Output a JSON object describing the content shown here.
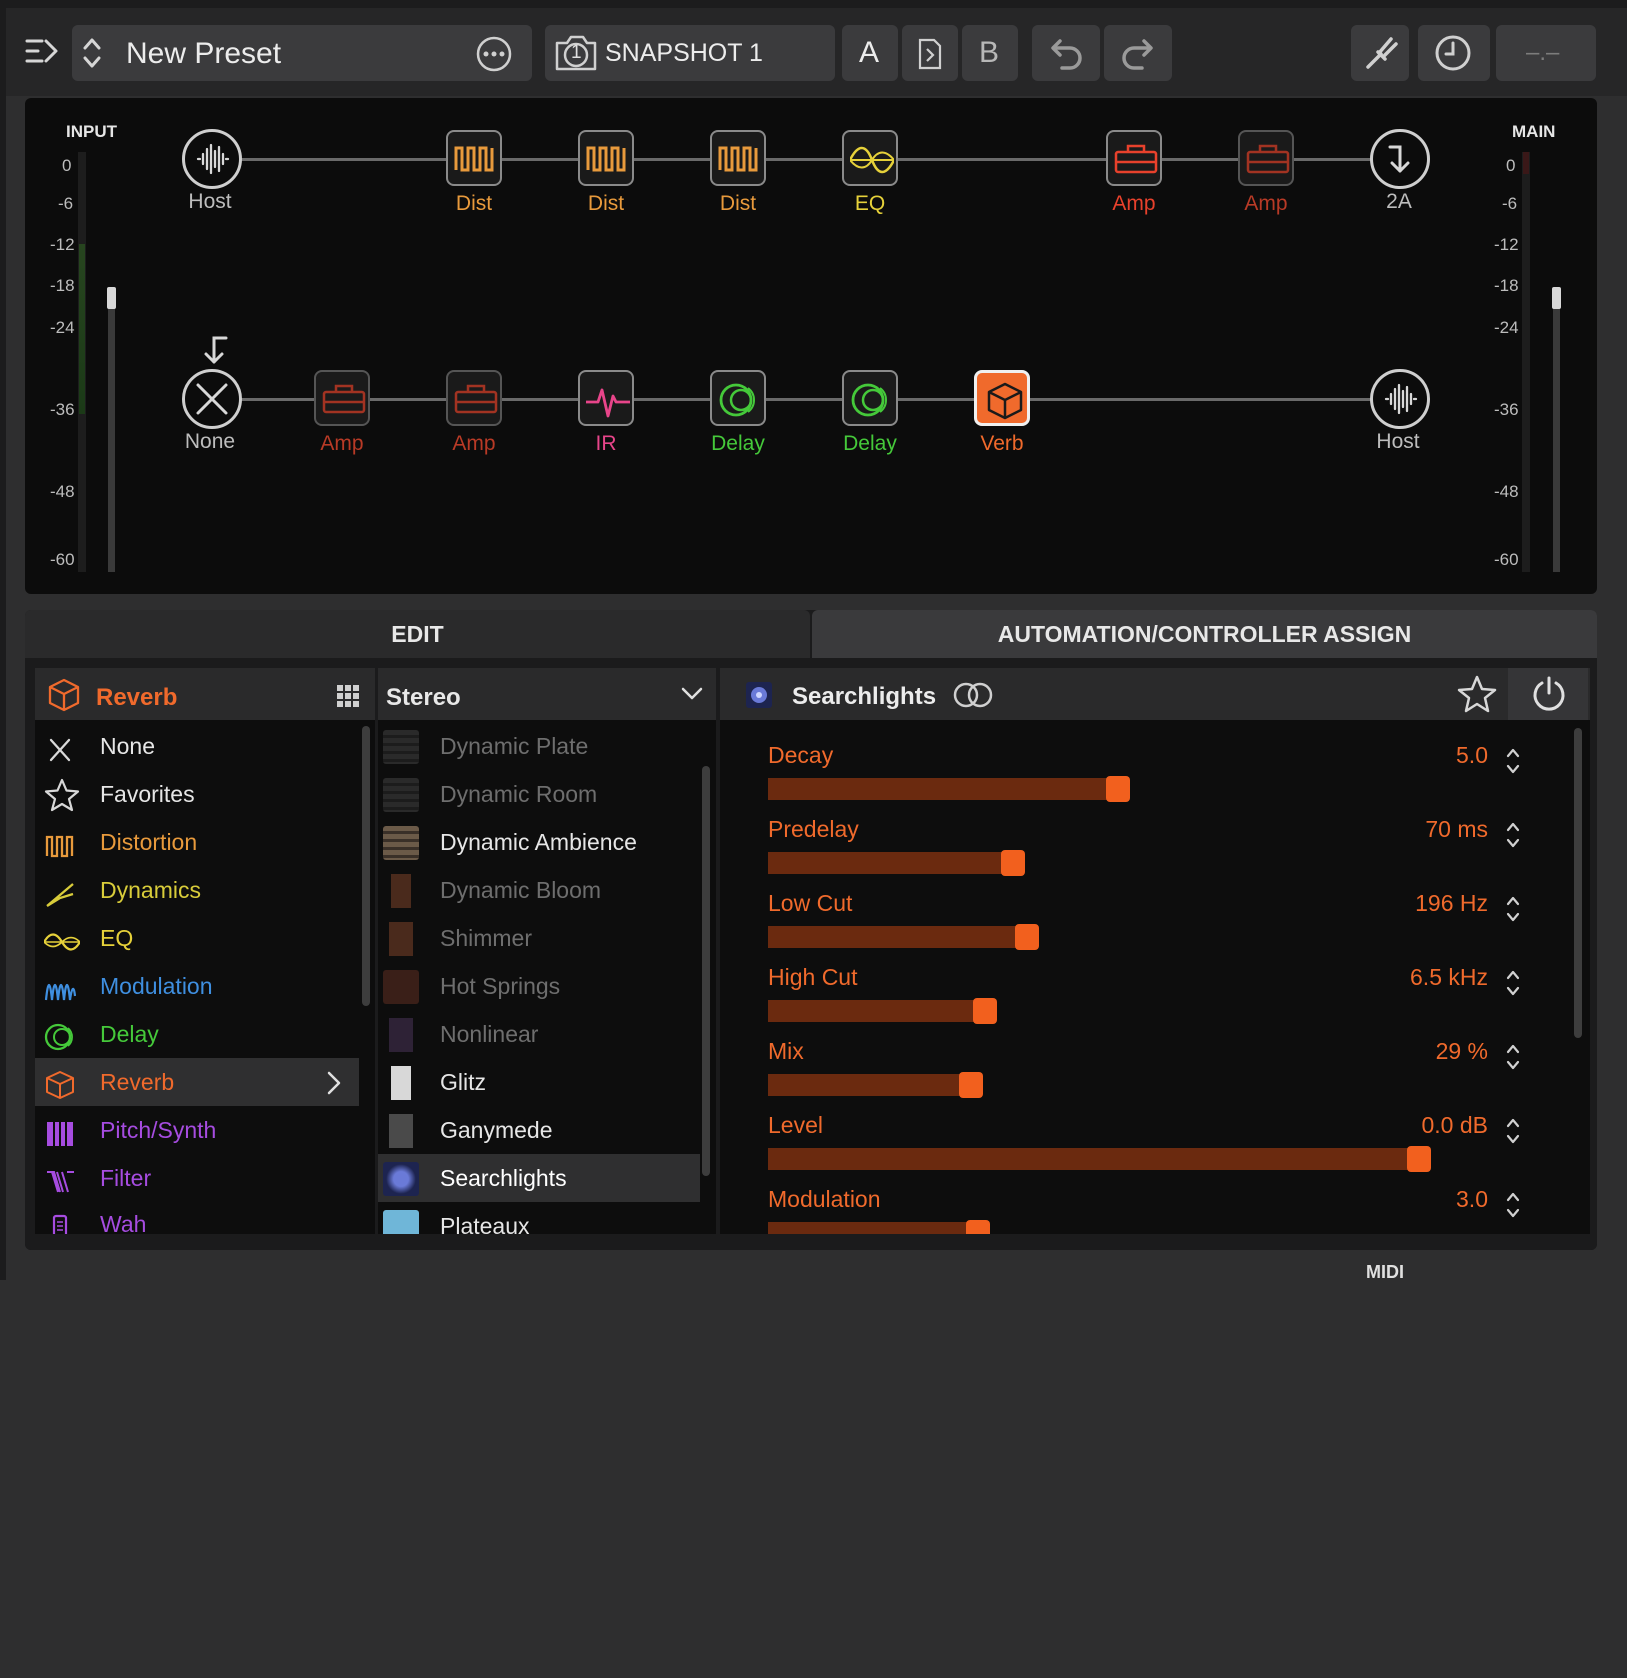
{
  "toolbar": {
    "preset_name": "New Preset",
    "snapshot_label": "SNAPSHOT 1",
    "snapshot_number": "1",
    "a_label": "A",
    "b_label": "B",
    "tempo_display": "–.–"
  },
  "signal_flow": {
    "input_label": "INPUT",
    "main_label": "MAIN",
    "meter_ticks_left": [
      "0",
      "-6",
      "-12",
      "-18",
      "-24",
      "-36",
      "-48",
      "-60"
    ],
    "meter_ticks_right": [
      "0",
      "-6",
      "-12",
      "-18",
      "-24",
      "-36",
      "-48",
      "-60"
    ],
    "path_a": [
      {
        "label": "Host",
        "type": "input",
        "color": "#bdbdbd"
      },
      {
        "label": "Dist",
        "type": "distortion",
        "color": "#e89a3c"
      },
      {
        "label": "Dist",
        "type": "distortion",
        "color": "#e89a3c"
      },
      {
        "label": "Dist",
        "type": "distortion",
        "color": "#e89a3c"
      },
      {
        "label": "EQ",
        "type": "eq",
        "color": "#e6d13a"
      },
      {
        "label": "Amp",
        "type": "amp",
        "color": "#e8412c"
      },
      {
        "label": "Amp",
        "type": "amp",
        "color": "#e8412c"
      },
      {
        "label": "2A",
        "type": "output",
        "color": "#bdbdbd"
      }
    ],
    "path_b": [
      {
        "label": "None",
        "type": "none",
        "color": "#bdbdbd"
      },
      {
        "label": "Amp",
        "type": "amp",
        "color": "#e8412c"
      },
      {
        "label": "Amp",
        "type": "amp",
        "color": "#e8412c"
      },
      {
        "label": "IR",
        "type": "ir",
        "color": "#e8458a"
      },
      {
        "label": "Delay",
        "type": "delay",
        "color": "#45c93a"
      },
      {
        "label": "Delay",
        "type": "delay",
        "color": "#45c93a"
      },
      {
        "label": "Verb",
        "type": "reverb",
        "color": "#f06a2c"
      },
      {
        "label": "Host",
        "type": "output",
        "color": "#bdbdbd"
      }
    ]
  },
  "tabs": {
    "edit": "EDIT",
    "automation": "AUTOMATION/CONTROLLER ASSIGN"
  },
  "category_panel": {
    "header": "Reverb",
    "items": [
      {
        "label": "None",
        "color": "#e6e6e6",
        "icon": "x-icon"
      },
      {
        "label": "Favorites",
        "color": "#e6e6e6",
        "icon": "star-icon"
      },
      {
        "label": "Distortion",
        "color": "#e89a3c",
        "icon": "distortion-icon"
      },
      {
        "label": "Dynamics",
        "color": "#d8cc3a",
        "icon": "dynamics-icon"
      },
      {
        "label": "EQ",
        "color": "#e6d13a",
        "icon": "eq-icon"
      },
      {
        "label": "Modulation",
        "color": "#3f8fe0",
        "icon": "modulation-icon"
      },
      {
        "label": "Delay",
        "color": "#45c93a",
        "icon": "delay-icon"
      },
      {
        "label": "Reverb",
        "color": "#f06a2c",
        "icon": "reverb-icon"
      },
      {
        "label": "Pitch/Synth",
        "color": "#a64ce0",
        "icon": "pitch-icon"
      },
      {
        "label": "Filter",
        "color": "#a64ce0",
        "icon": "filter-icon"
      },
      {
        "label": "Wah",
        "color": "#a64ce0",
        "icon": "wah-icon"
      }
    ]
  },
  "model_panel": {
    "header": "Stereo",
    "items": [
      {
        "label": "Dynamic Plate",
        "enabled": false
      },
      {
        "label": "Dynamic Room",
        "enabled": false
      },
      {
        "label": "Dynamic Ambience",
        "enabled": true
      },
      {
        "label": "Dynamic Bloom",
        "enabled": false
      },
      {
        "label": "Shimmer",
        "enabled": false
      },
      {
        "label": "Hot Springs",
        "enabled": false
      },
      {
        "label": "Nonlinear",
        "enabled": false
      },
      {
        "label": "Glitz",
        "enabled": true
      },
      {
        "label": "Ganymede",
        "enabled": true
      },
      {
        "label": "Searchlights",
        "enabled": true
      },
      {
        "label": "Plateaux",
        "enabled": true
      }
    ]
  },
  "params_panel": {
    "title": "Searchlights",
    "params": [
      {
        "name": "Decay",
        "value": "5.0",
        "level": 0.5
      },
      {
        "name": "Predelay",
        "value": "70 ms",
        "level": 0.35
      },
      {
        "name": "Low Cut",
        "value": "196 Hz",
        "level": 0.37
      },
      {
        "name": "High Cut",
        "value": "6.5 kHz",
        "level": 0.31
      },
      {
        "name": "Mix",
        "value": "29 %",
        "level": 0.29
      },
      {
        "name": "Level",
        "value": "0.0 dB",
        "level": 0.93
      },
      {
        "name": "Modulation",
        "value": "3.0",
        "level": 0.3
      }
    ]
  },
  "footer": {
    "midi_label": "MIDI"
  },
  "colors": {
    "accent": "#f06a2c",
    "background": "#0c0c0c"
  }
}
